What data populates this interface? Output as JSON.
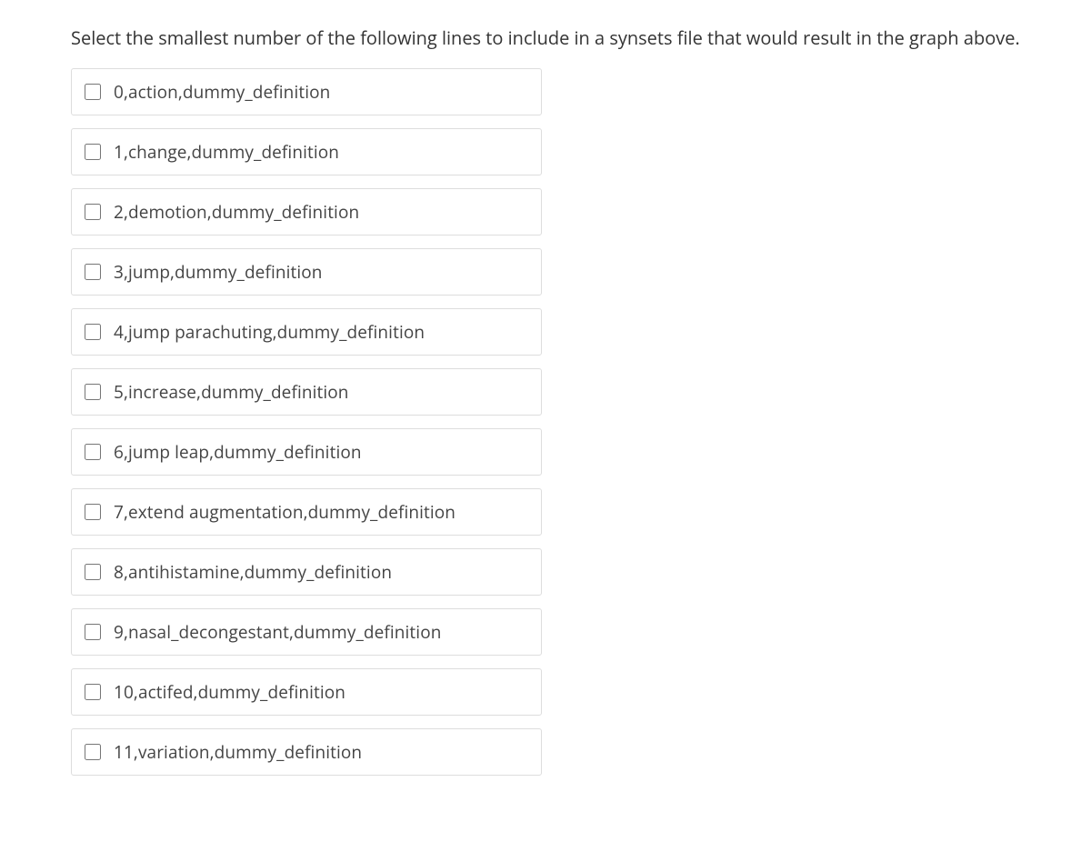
{
  "question": "Select the smallest number of the following lines to include in a synsets file that would result in the graph above.",
  "options": [
    {
      "label": "0,action,dummy_definition"
    },
    {
      "label": "1,change,dummy_definition"
    },
    {
      "label": "2,demotion,dummy_definition"
    },
    {
      "label": "3,jump,dummy_definition"
    },
    {
      "label": "4,jump parachuting,dummy_definition"
    },
    {
      "label": "5,increase,dummy_definition"
    },
    {
      "label": "6,jump leap,dummy_definition"
    },
    {
      "label": "7,extend augmentation,dummy_definition"
    },
    {
      "label": "8,antihistamine,dummy_definition"
    },
    {
      "label": "9,nasal_decongestant,dummy_definition"
    },
    {
      "label": "10,actifed,dummy_definition"
    },
    {
      "label": "11,variation,dummy_definition"
    }
  ]
}
